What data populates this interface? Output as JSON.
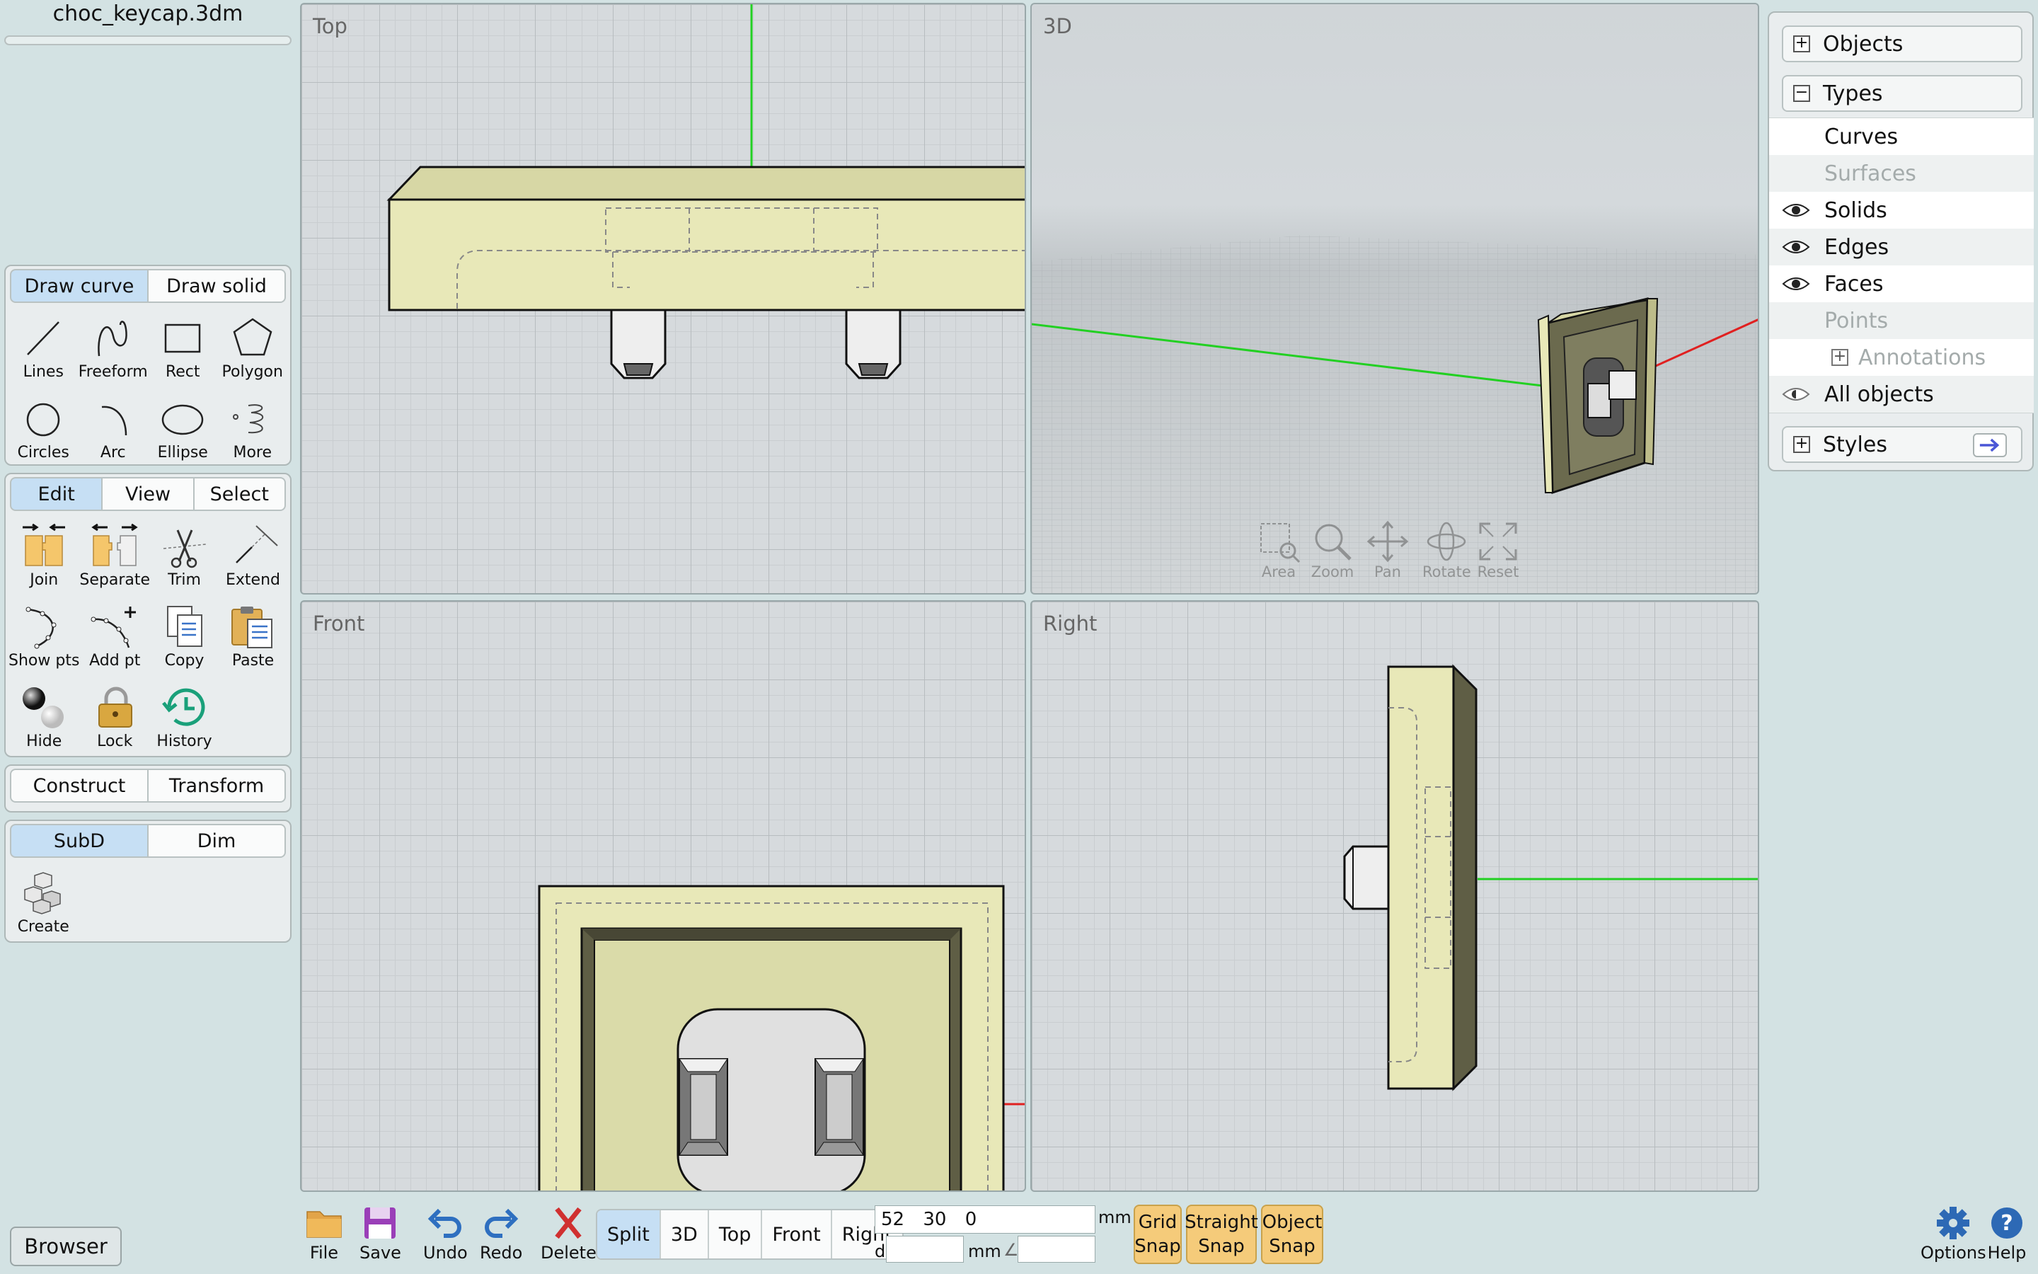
{
  "file": {
    "name": "choc_keycap.3dm"
  },
  "draw_panel": {
    "tabs": [
      "Draw curve",
      "Draw solid"
    ],
    "tools": [
      "Lines",
      "Freeform",
      "Rect",
      "Polygon",
      "Circles",
      "Arc",
      "Ellipse",
      "More"
    ]
  },
  "edit_panel": {
    "tabs": [
      "Edit",
      "View",
      "Select"
    ],
    "tools": [
      "Join",
      "Separate",
      "Trim",
      "Extend",
      "Show pts",
      "Add pt",
      "Copy",
      "Paste",
      "Hide",
      "Lock",
      "History"
    ]
  },
  "construct_panel": {
    "tabs": [
      "Construct",
      "Transform"
    ]
  },
  "subd_panel": {
    "tabs": [
      "SubD",
      "Dim"
    ],
    "tools": [
      "Create"
    ]
  },
  "browser_button": "Browser",
  "viewports": {
    "top": "Top",
    "3d": "3D",
    "front": "Front",
    "right": "Right"
  },
  "nav_controls": [
    "Area",
    "Zoom",
    "Pan",
    "Rotate",
    "Reset"
  ],
  "right_panel": {
    "objects": "Objects",
    "types": "Types",
    "type_items": [
      "Curves",
      "Surfaces",
      "Solids",
      "Edges",
      "Faces",
      "Points",
      "Annotations",
      "All objects"
    ],
    "styles": "Styles"
  },
  "bottom": {
    "file": "File",
    "save": "Save",
    "undo": "Undo",
    "redo": "Redo",
    "delete": "Delete",
    "views": [
      "Split",
      "3D",
      "Top",
      "Front",
      "Right"
    ],
    "coords": "52 30 0",
    "unit": "mm",
    "d_label": "d",
    "angle_symbol": "∠",
    "snaps": [
      [
        "Grid",
        "Snap"
      ],
      [
        "Straight",
        "Snap"
      ],
      [
        "Object",
        "Snap"
      ]
    ],
    "options": "Options",
    "help": "Help"
  },
  "colors": {
    "accent_tab": "#c6dff4",
    "snap": "#f5cb7a",
    "model": "#e8e8b8",
    "x_axis": "#e02020",
    "y_axis": "#22d022"
  }
}
